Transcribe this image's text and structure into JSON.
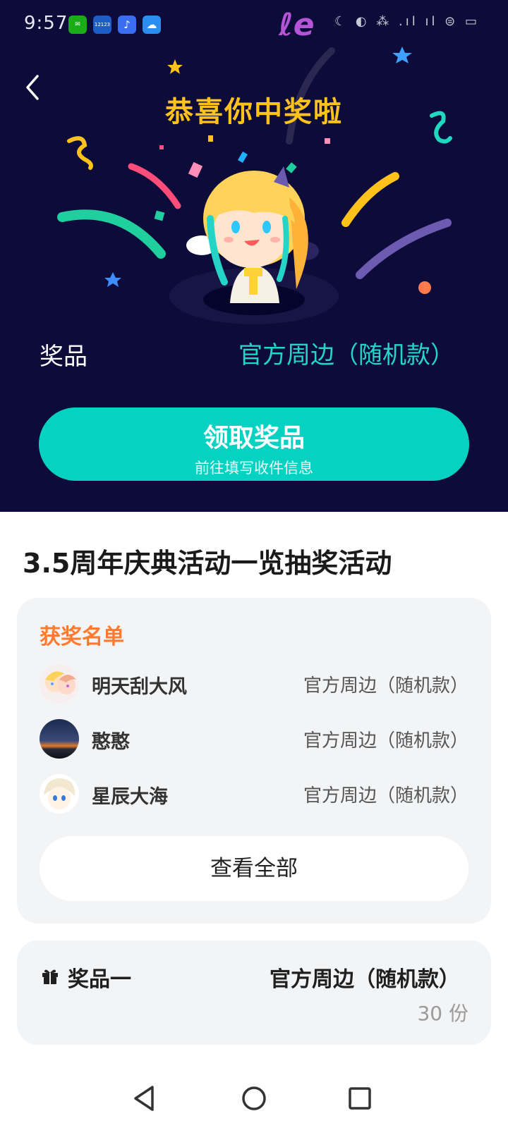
{
  "status_bar": {
    "time": "9:57",
    "apps": [
      {
        "name": "wechat-icon",
        "color": "#1aad19",
        "label": "✉"
      },
      {
        "name": "traffic-12123-icon",
        "color": "#1e5cc8",
        "label": "12123"
      },
      {
        "name": "music-icon",
        "color": "#3a6df0",
        "label": "♪"
      },
      {
        "name": "weather-icon",
        "color": "#2a8ef0",
        "label": "☁"
      }
    ],
    "right_indicators": "☾ ◐ ⁂ .ıl ıl ⊜ ▭"
  },
  "hero": {
    "background": "#0d0b3a",
    "title": "恭喜你中奖啦",
    "prize_label": "奖品",
    "prize_value": "官方周边（随机款）",
    "claim_button": {
      "title": "领取奖品",
      "subtitle": "前往填写收件信息"
    }
  },
  "activity": {
    "title": "3.5周年庆典活动一览抽奖活动"
  },
  "winners": {
    "heading": "获奖名单",
    "list": [
      {
        "name": "明天刮大风",
        "prize": "官方周边（随机款）"
      },
      {
        "name": "憨憨",
        "prize": "官方周边（随机款）"
      },
      {
        "name": "星辰大海",
        "prize": "官方周边（随机款）"
      }
    ],
    "view_all": "查看全部"
  },
  "prize_item": {
    "label": "奖品一",
    "value": "官方周边（随机款）",
    "count": "30 份"
  },
  "colors": {
    "accent_teal": "#06d2c2",
    "title_yellow": "#ffc21a",
    "heading_orange": "#ff7a2f"
  }
}
